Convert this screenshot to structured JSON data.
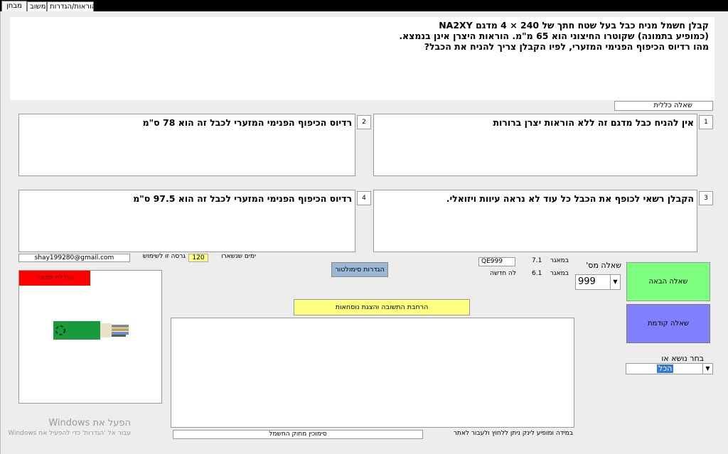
{
  "tabs": [
    {
      "label": "מבחן"
    },
    {
      "label": "משוב"
    },
    {
      "label": "הוראות/הגדרות"
    }
  ],
  "question": {
    "line1": "קבלן חשמל מניח כבל בעל שטח חתך של 240 × 4 מדגם NA2XY",
    "line2": "(כמופיע בתמונה) שקוטרו החיצוני הוא 65 מ\"מ. הוראות היצרן אינן בנמצא.",
    "line3": "מהו רדיוס הכיפוף הפנימי המזערי, לפיו הקבלן צריך להניח את הכבל?",
    "category": "שאלה כללית"
  },
  "answers": [
    {
      "num": "1",
      "text": "אין להניח כבל מדגם זה ללא הוראות יצרן ברורות"
    },
    {
      "num": "2",
      "text": "רדיוס הכיפוף הפנימי המזערי לכבל זה הוא 78 ס\"מ"
    },
    {
      "num": "3",
      "text": "הקבלן רשאי לכופף את הכבל כל עוד לא נראה עיוות ויזואלי."
    },
    {
      "num": "4",
      "text": "רדיוס הכיפוף הפנימי המזערי לכבל זה הוא 97.5 ס\"מ"
    }
  ],
  "license": {
    "email": "shay199280@gmail.com",
    "version_label": "גרסה זו לשימוש",
    "days": "120",
    "days_label": "ימים שנשארו"
  },
  "image": {
    "enlarge_label": "הגדלת תמונה"
  },
  "controls": {
    "sim_settings": "הגדרות סימולטור",
    "explain": "הרחבת התשובה והצגת נוסחאות",
    "question_num_label": "שאלה מס'",
    "question_num": "999",
    "code": "QE999",
    "in_pool_label": "במאגר",
    "in_pool_value": "7.1",
    "new_label": "לה חדשה",
    "new_value": "6.1",
    "next": "שאלה הבאה",
    "prev": "שאלה קודמת",
    "topic_label": "בחר נושא או",
    "topic_value": "הכל",
    "footer_link": "במידה ומופיע לינק ניתן ללחוץ ולעבור לאתר",
    "footer_box": "סימוכין מחוק החשמל"
  },
  "watermark": {
    "title": "הפעל את Windows",
    "subtitle": "עבור אל 'הגדרות' כדי להפעיל את Windows"
  },
  "colors": {
    "next_button": "#7fff7f",
    "prev_button": "#8080ff",
    "enlarge_button": "#ff0000",
    "explain_button": "#ffff80",
    "sim_button": "#9ab7d3",
    "cable_jacket": "#1a9a3c"
  }
}
